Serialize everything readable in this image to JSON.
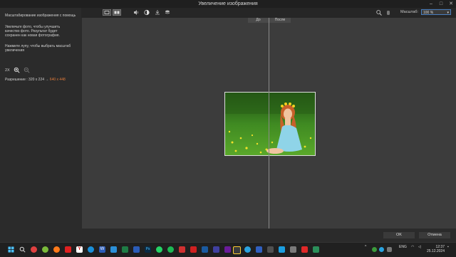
{
  "window": {
    "title": "Увеличение изображения",
    "controls": [
      "–",
      "□",
      "✕"
    ]
  },
  "toolbar": {
    "zoom_label": "Масштаб:",
    "zoom_value": "100 %"
  },
  "sidebar": {
    "heading": "Масштабирование изображения с помощь",
    "desc": "Увеличьте фото, чтобы улучшить качество фото. Результат будет сохранен как новая фотография.",
    "hint": "Нажмите лупу, чтобы выбрать масштаб увеличения",
    "zoom_factor": "2X",
    "resolution_label": "Разрешение : 320 x 224 →",
    "resolution_new": "640 x 448"
  },
  "canvas": {
    "before_label": "До",
    "after_label": "После"
  },
  "footer": {
    "ok_label": "OK",
    "cancel_label": "Отмена"
  },
  "taskbar": {
    "tray_lang": "ENG",
    "time": "12:37",
    "date": "25.12.2024",
    "accent": "#4a7fc0"
  }
}
